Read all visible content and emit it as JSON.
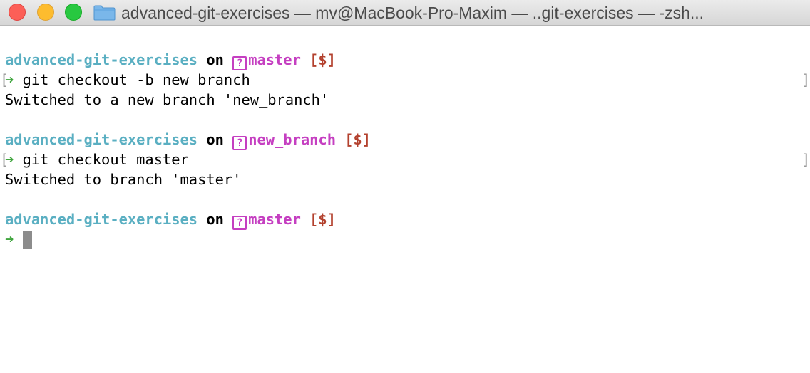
{
  "window": {
    "title": "advanced-git-exercises — mv@MacBook-Pro-Maxim — ..git-exercises — -zsh..."
  },
  "colors": {
    "directory": "#5aafc2",
    "branch": "#c53fc1",
    "status": "#b3412e",
    "arrow": "#3fa53d"
  },
  "icons": {
    "arrow": "➜",
    "unknown": "?"
  },
  "terminal": {
    "prompt1": {
      "directory": "advanced-git-exercises",
      "on": "on",
      "branch": "master",
      "status": "[$]"
    },
    "cmd1": "git checkout -b new_branch",
    "out1": "Switched to a new branch 'new_branch'",
    "prompt2": {
      "directory": "advanced-git-exercises",
      "on": "on",
      "branch": "new_branch",
      "status": "[$]"
    },
    "cmd2": "git checkout master",
    "out2": "Switched to branch 'master'",
    "prompt3": {
      "directory": "advanced-git-exercises",
      "on": "on",
      "branch": "master",
      "status": "[$]"
    },
    "left_bracket": "[",
    "right_bracket": "]"
  }
}
